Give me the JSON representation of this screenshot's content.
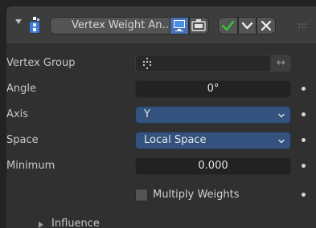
{
  "header": {
    "modifier_name": "Vertex Weight An...",
    "icon": "vertex-weight-modifier-icon",
    "editmode_active_color": "#4772b3",
    "apply_check_color": "#37c837",
    "delete_symbol": "✕"
  },
  "properties": {
    "vertex_group": {
      "label": "Vertex Group",
      "value": "",
      "invert_symbol": "↔"
    },
    "angle": {
      "label": "Angle",
      "value": "0°"
    },
    "axis": {
      "label": "Axis",
      "value": "Y"
    },
    "space": {
      "label": "Space",
      "value": "Local Space"
    },
    "minimum": {
      "label": "Minimum",
      "value": "0.000"
    },
    "multiply_weights": {
      "label": "Multiply Weights",
      "checked": false
    }
  },
  "subpanels": {
    "influence": {
      "label": "Influence",
      "expanded": false
    }
  },
  "colors": {
    "panel_bg": "#303030",
    "header_bg": "#3d3d3d",
    "field_bg": "#545454",
    "dark_field_bg": "#222222",
    "dropdown_bg": "#33537e",
    "text": "#d8d8d8"
  }
}
